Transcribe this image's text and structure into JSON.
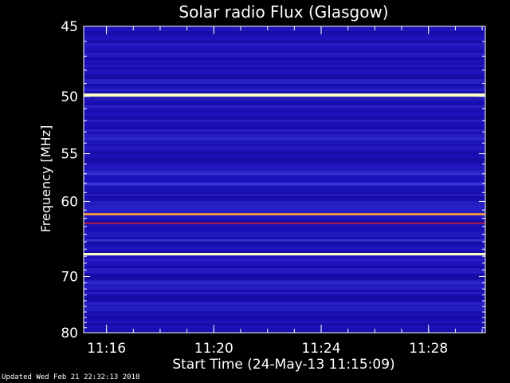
{
  "chart_data": {
    "type": "heatmap",
    "title": "Solar radio Flux (Glasgow)",
    "xlabel": "Start Time (24-May-13 11:15:09)",
    "ylabel": "Frequency [MHz]",
    "x_ticks": [
      "11:16",
      "11:20",
      "11:24",
      "11:28"
    ],
    "y_ticks": [
      "45",
      "50",
      "55",
      "60",
      "70",
      "80"
    ],
    "ylim": [
      45,
      80
    ],
    "y_scale": "reciprocal",
    "x_range_minutes": [
      "11:15:09",
      "11:30:07"
    ],
    "colormap": [
      "#000068",
      "#1c10b8",
      "#3a3ad8",
      "#e01010",
      "#ff8a20",
      "#ffffc0"
    ],
    "background_level": 0.22,
    "bands": [
      {
        "freq": 49.9,
        "level": 1.0,
        "width": 0.25
      },
      {
        "freq": 53.6,
        "level": 0.35,
        "width": 0.3
      },
      {
        "freq": 57.0,
        "level": 0.4,
        "width": 0.25
      },
      {
        "freq": 58.1,
        "level": 0.45,
        "width": 0.25
      },
      {
        "freq": 61.5,
        "level": 0.85,
        "width": 0.25
      },
      {
        "freq": 62.6,
        "level": 0.6,
        "width": 0.2
      },
      {
        "freq": 64.8,
        "level": 0.4,
        "width": 0.25
      },
      {
        "freq": 66.7,
        "level": 1.0,
        "width": 0.35
      },
      {
        "freq": 71.0,
        "level": 0.38,
        "width": 0.3
      },
      {
        "freq": 74.5,
        "level": 0.3,
        "width": 0.6
      }
    ]
  },
  "footer": "Updated Wed Feb 21 22:32:13 2018"
}
